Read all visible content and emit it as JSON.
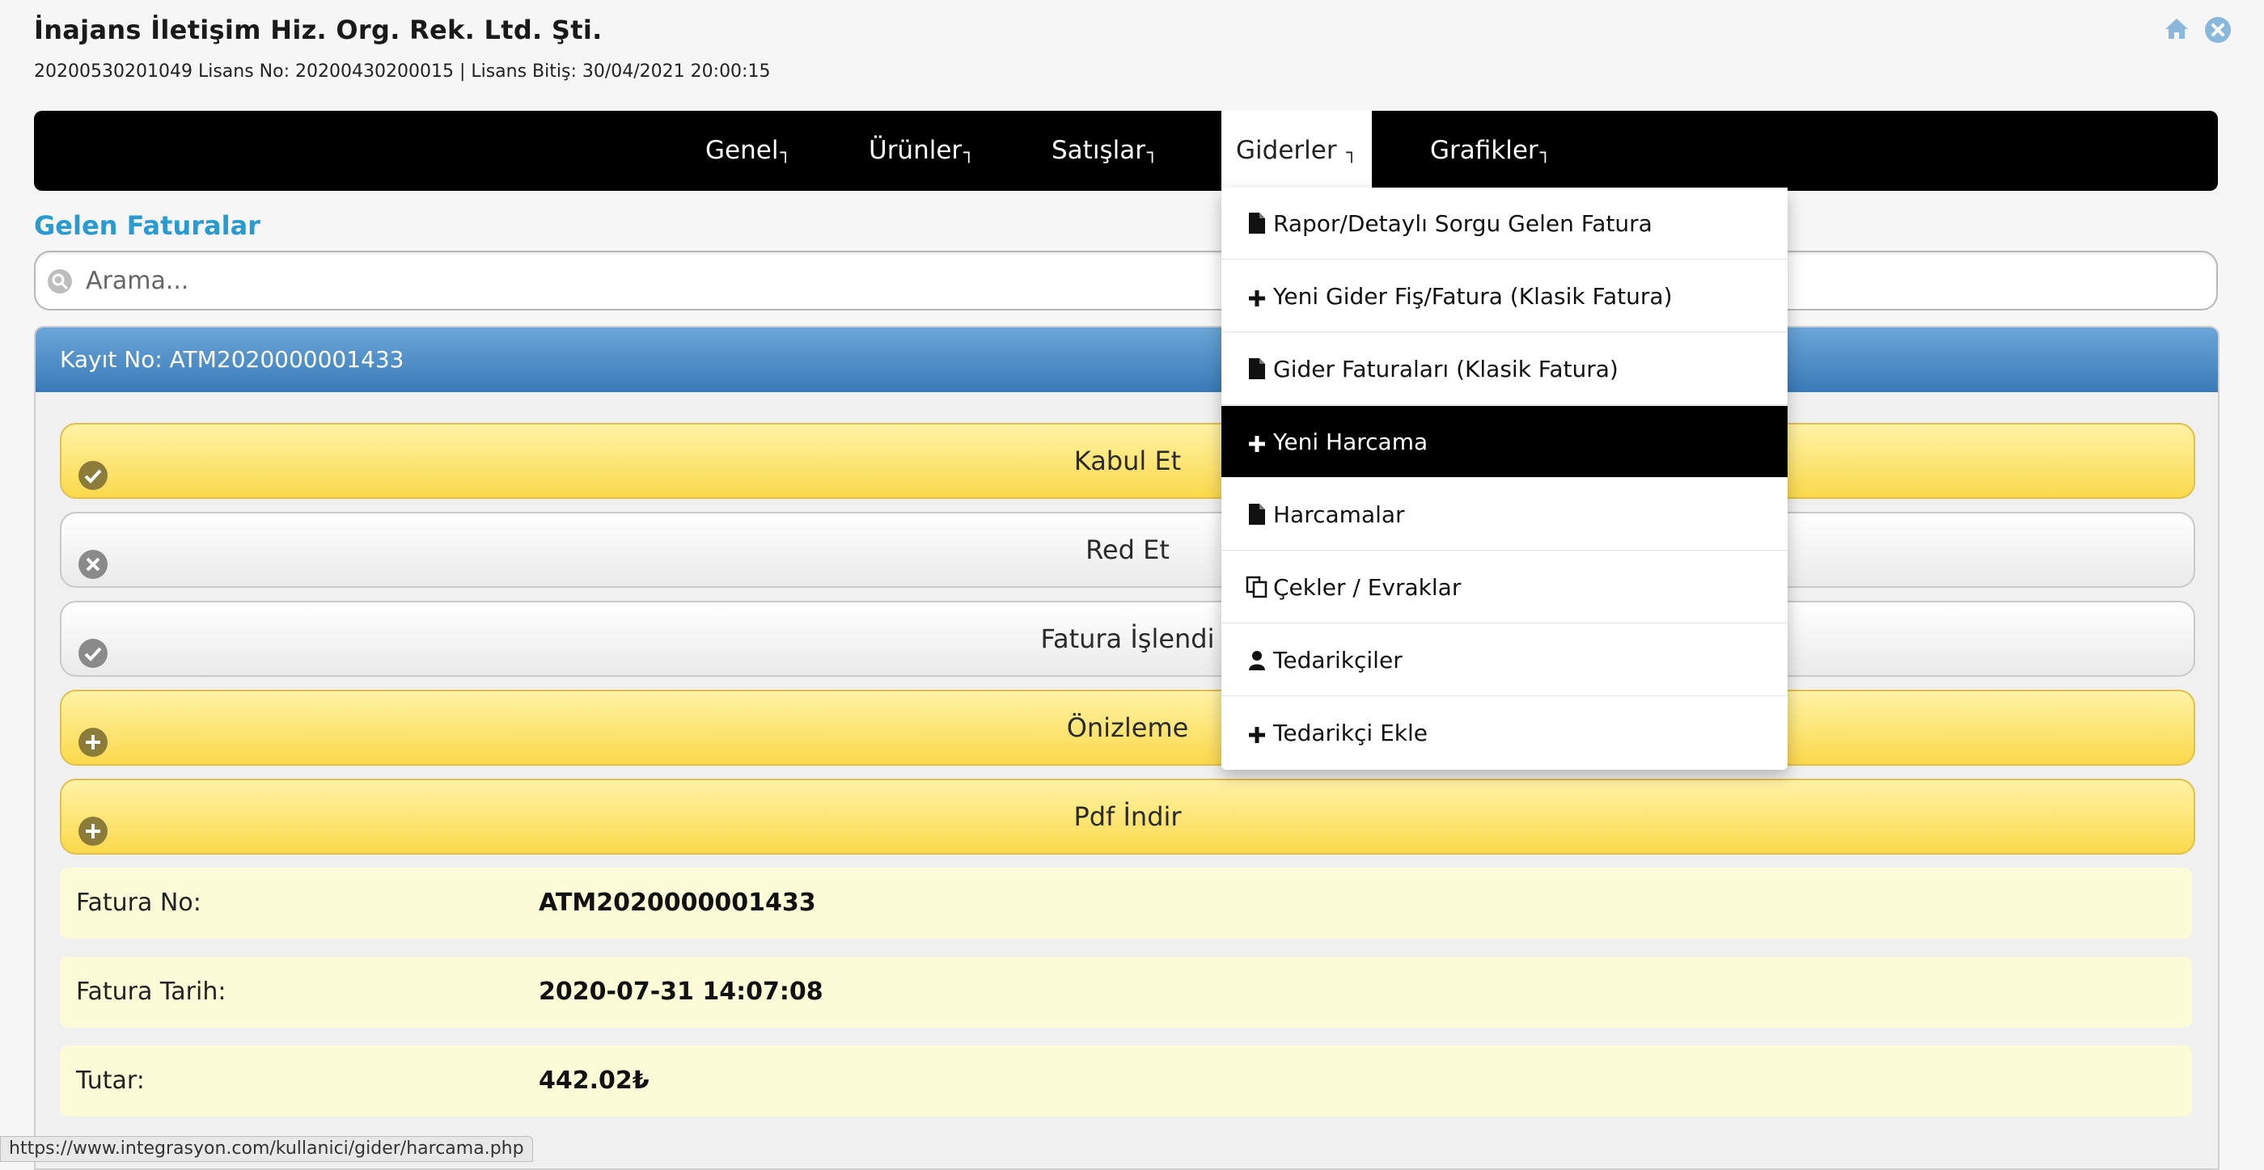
{
  "header": {
    "company": "İnajans İletişim Hiz. Org. Rek. Ltd. Şti.",
    "license_line": "20200530201049 Lisans No: 20200430200015 | Lisans Bitiş: 30/04/2021 20:00:15"
  },
  "nav": {
    "items": [
      {
        "label": "Genel",
        "caret": "┐"
      },
      {
        "label": "Ürünler",
        "caret": "┐"
      },
      {
        "label": "Satışlar",
        "caret": "┐"
      },
      {
        "label": "Giderler ",
        "caret": "┐"
      },
      {
        "label": "Grafikler",
        "caret": "┐"
      }
    ]
  },
  "page": {
    "section_title": "Gelen Faturalar",
    "search_placeholder": "Arama..."
  },
  "panel": {
    "header": "Kayıt No: ATM2020000001433",
    "buttons": [
      "Kabul Et",
      "Red Et",
      "Fatura İşlendi",
      "Önizleme",
      "Pdf İndir"
    ],
    "rows": [
      {
        "label": "Fatura No:",
        "value": "ATM2020000001433"
      },
      {
        "label": "Fatura Tarih:",
        "value": "2020-07-31 14:07:08"
      },
      {
        "label": "Tutar:",
        "value": "442.02₺"
      }
    ]
  },
  "dropdown": {
    "items": [
      {
        "label": "Rapor/Detaylı Sorgu Gelen Fatura",
        "icon": "file-icon"
      },
      {
        "label": "Yeni Gider Fiş/Fatura (Klasik Fatura)",
        "icon": "plus-icon"
      },
      {
        "label": "Gider Faturaları (Klasik Fatura)",
        "icon": "file-icon"
      },
      {
        "label": "Yeni Harcama",
        "icon": "plus-icon"
      },
      {
        "label": "Harcamalar",
        "icon": "file-icon"
      },
      {
        "label": "Çekler / Evraklar",
        "icon": "copy-icon"
      },
      {
        "label": "Tedarikçiler",
        "icon": "user-icon"
      },
      {
        "label": "Tedarikçi Ekle",
        "icon": "plus-icon"
      }
    ]
  },
  "status_bar": {
    "url": "https://www.integrasyon.com/kullanici/gider/harcama.php"
  }
}
